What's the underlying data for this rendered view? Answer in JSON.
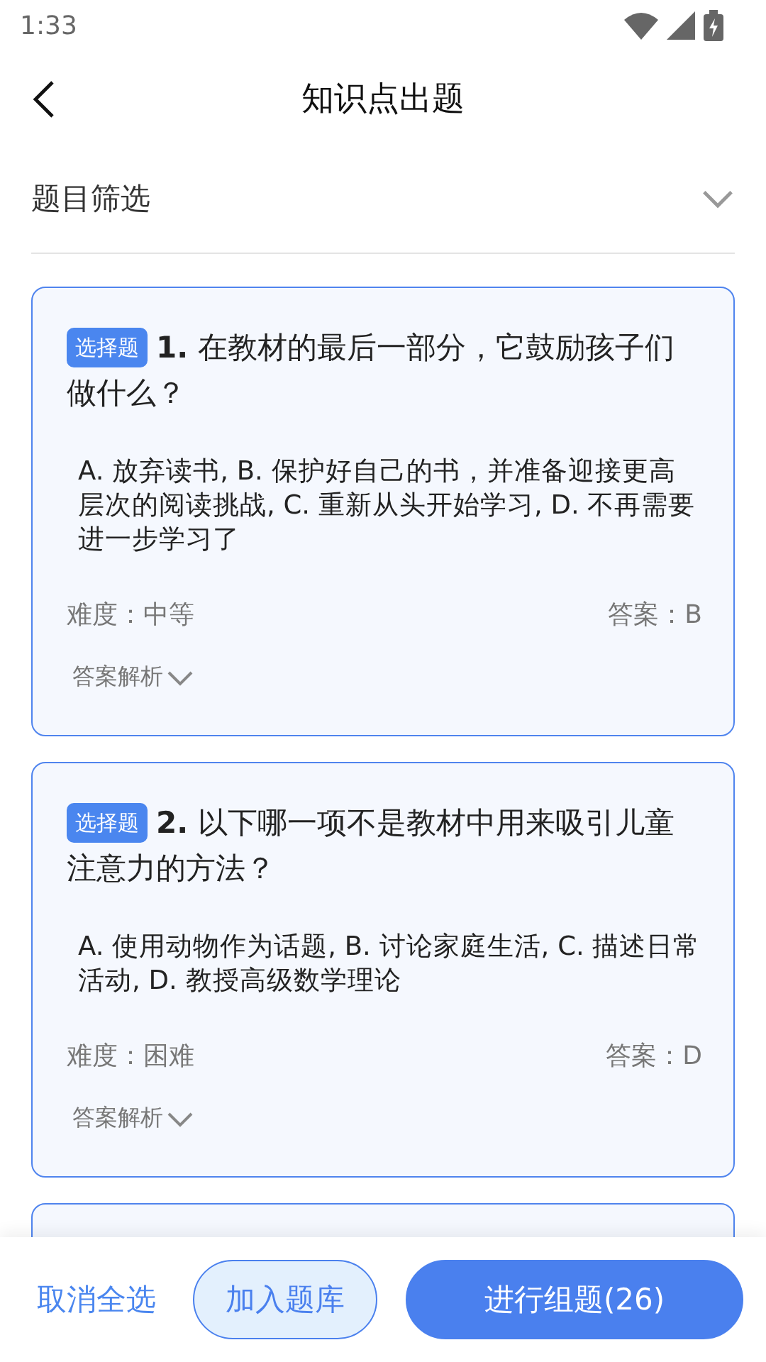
{
  "status_bar": {
    "time": "1:33"
  },
  "header": {
    "title": "知识点出题"
  },
  "filter": {
    "label": "题目筛选",
    "expanded": false
  },
  "questions": [
    {
      "kind": "question",
      "type_tag": "选择题",
      "number": "1.",
      "text": "在教材的最后一部分，它鼓励孩子们做什么？",
      "options": "A. 放弃读书, B. 保护好自己的书，并准备迎接更高层次的阅读挑战, C. 重新从头开始学习, D. 不再需要进一步学习了",
      "difficulty": "难度：中等",
      "answer": "答案：B",
      "analysis": "答案解析",
      "selected": true
    },
    {
      "kind": "question",
      "type_tag": "选择题",
      "number": "2.",
      "text": "以下哪一项不是教材中用来吸引儿童注意力的方法？",
      "options": "A. 使用动物作为话题, B. 讨论家庭生活, C. 描述日常活动, D. 教授高级数学理论",
      "difficulty": "难度：困难",
      "answer": "答案：D",
      "analysis": "答案解析",
      "selected": true
    },
    {
      "kind": "partial",
      "selected": true
    }
  ],
  "bottom_bar": {
    "deselect_all": "取消全选",
    "add_to_bank": "加入题库",
    "compose": "进行组题(26)"
  }
}
